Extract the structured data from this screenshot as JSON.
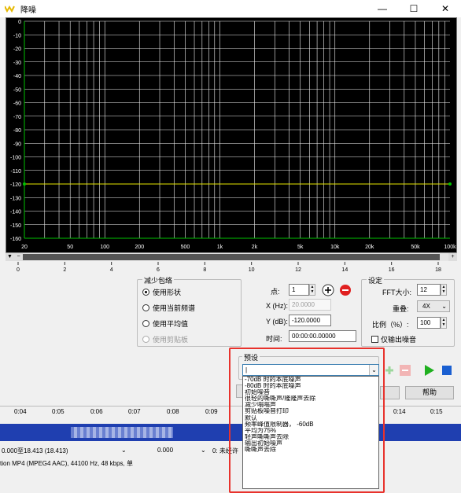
{
  "window": {
    "title": "降噪",
    "min": "—",
    "max": "☐",
    "close": "✕"
  },
  "plot": {
    "y_labels": [
      "0",
      "-10",
      "-20",
      "-30",
      "-40",
      "-50",
      "-60",
      "-70",
      "-80",
      "-90",
      "-100",
      "-110",
      "-120",
      "-130",
      "-140",
      "-150",
      "-160"
    ],
    "x_labels": [
      "20",
      "50",
      "100",
      "200",
      "500",
      "1k",
      "2k",
      "5k",
      "10k",
      "20k",
      "50k",
      "100k"
    ],
    "curve_db": -120,
    "colors": {
      "grid": "#f0f0f0",
      "curve": "#e6e600",
      "green": "#00c000"
    }
  },
  "ruler_labels": [
    "0",
    "2",
    "4",
    "6",
    "8",
    "10",
    "12",
    "14",
    "16",
    "18"
  ],
  "reduce_envelope": {
    "title": "减少包络",
    "options": [
      "使用形状",
      "使用当前频谱",
      "使用平均值",
      "使用剪贴板"
    ],
    "selected_index": 0
  },
  "points": {
    "point_label": "点:",
    "point_value": "1",
    "x_label": "X (Hz):",
    "x_value": "20.0000",
    "y_label": "Y (dB):",
    "y_value": "-120.0000",
    "time_label": "时间:",
    "time_value": "00:00:00.00000"
  },
  "settings": {
    "title": "设定",
    "fft_label": "FFT大小:",
    "fft_value": "12",
    "overlap_label": "重叠:",
    "overlap_value": "4X",
    "ratio_label": "比例（%）:",
    "ratio_value": "100",
    "noise_only_label": "仅输出噪音"
  },
  "preset": {
    "title": "预设",
    "items": [
      "-70dB 时的本底噪声",
      "-80dB 时的本底噪声",
      "初始噪音",
      "很轻的嘶嘶声/隆隆声去除",
      "减少嗡嗡声",
      "剪贴板噪音打印",
      "默认",
      "频率峰值限制器， -60dB",
      "平均为75%",
      "轻声嘶嘶声去除",
      "输出初始噪声",
      "嘶嘶声去除"
    ]
  },
  "buttons": {
    "help": "帮助"
  },
  "timeline": {
    "time_marks": [
      "0:04",
      "0:05",
      "0:06",
      "0:07",
      "0:08",
      "0:09",
      "0:14",
      "0:15"
    ],
    "selection": "0.000至18.413  (18.413)",
    "pos": "0.000",
    "status_right": "0:  未经许",
    "format": "tion MP4 (MPEG4 AAC), 44100 Hz, 48 kbps, 单"
  }
}
